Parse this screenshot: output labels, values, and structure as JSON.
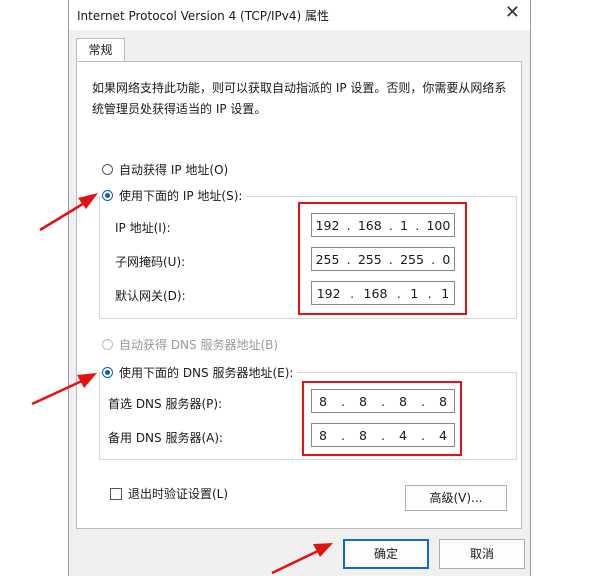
{
  "window": {
    "title": "Internet Protocol Version 4 (TCP/IPv4) 属性",
    "close_glyph": "✕"
  },
  "tab": {
    "label": "常规"
  },
  "description": "如果网络支持此功能，则可以获取自动指派的 IP 设置。否则，你需要从网络系统管理员处获得适当的 IP 设置。",
  "ip_section": {
    "auto_label": "自动获得 IP 地址(O)",
    "manual_label": "使用下面的 IP 地址(S):",
    "fields": [
      {
        "label": "IP 地址(I):",
        "octets": [
          "192",
          "168",
          "1",
          "100"
        ]
      },
      {
        "label": "子网掩码(U):",
        "octets": [
          "255",
          "255",
          "255",
          "0"
        ]
      },
      {
        "label": "默认网关(D):",
        "octets": [
          "192",
          "168",
          "1",
          "1"
        ]
      }
    ]
  },
  "dns_section": {
    "auto_label": "自动获得 DNS 服务器地址(B)",
    "manual_label": "使用下面的 DNS 服务器地址(E):",
    "fields": [
      {
        "label": "首选 DNS 服务器(P):",
        "octets": [
          "8",
          "8",
          "8",
          "8"
        ]
      },
      {
        "label": "备用 DNS 服务器(A):",
        "octets": [
          "8",
          "8",
          "4",
          "4"
        ]
      }
    ]
  },
  "validate_label": "退出时验证设置(L)",
  "buttons": {
    "advanced": "高级(V)...",
    "ok": "确定",
    "cancel": "取消"
  },
  "colors": {
    "highlight_red": "#e21212",
    "accent_blue": "#0a5bc4"
  }
}
